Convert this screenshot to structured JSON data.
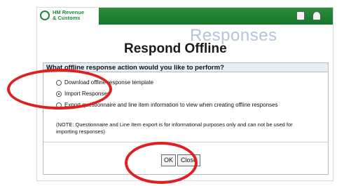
{
  "brand": {
    "logo_line1": "HM Revenue",
    "logo_line2": "& Customs"
  },
  "header": {
    "watermark": "Responses",
    "title": "Respond Offline"
  },
  "panel": {
    "heading": "What offline response action would you like to perform?",
    "options": [
      {
        "label": "Download offline response template",
        "selected": false
      },
      {
        "label": "Import Responses",
        "selected": true
      },
      {
        "label": "Export questionnaire and line item information to view when creating offline responses",
        "selected": false
      }
    ],
    "note": "(NOTE: Questionnaire and Line Item export is for informational purposes only and can not be used for importing responses)"
  },
  "buttons": {
    "ok": "OK",
    "close": "Close"
  },
  "colors": {
    "topbar": "#1b8a3a",
    "annotation": "#e02020",
    "watermark": "#b7c3da"
  },
  "icons": [
    "print-icon",
    "user-icon",
    "crest-icon"
  ]
}
